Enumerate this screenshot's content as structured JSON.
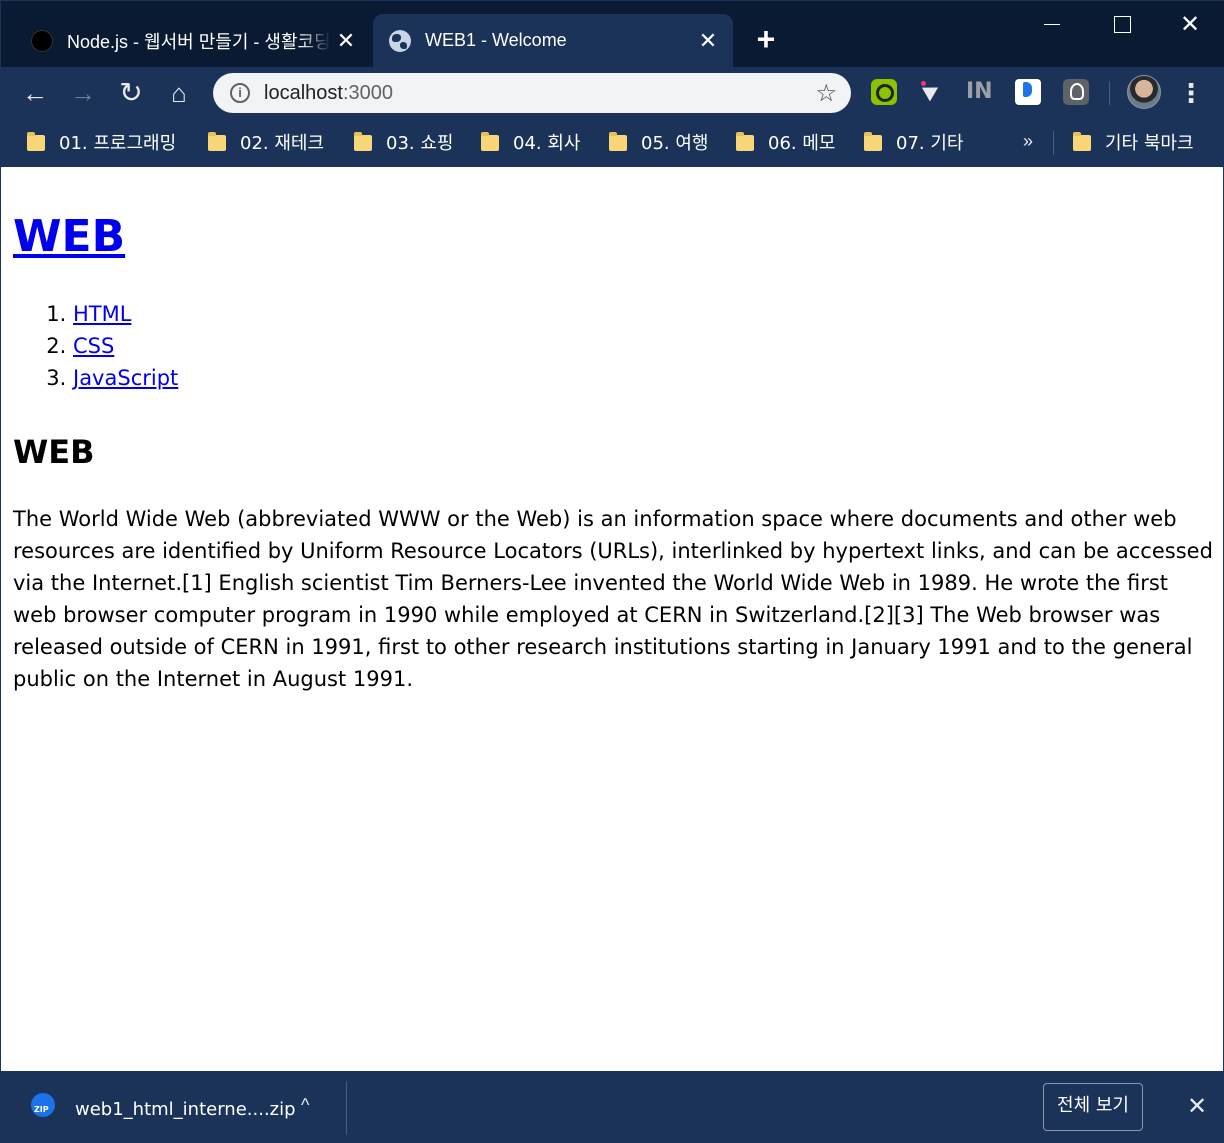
{
  "tabs": [
    {
      "title": "Node.js - 웹서버 만들기 - 생활코딩",
      "close": "✕"
    },
    {
      "title": "WEB1 - Welcome",
      "close": "✕"
    }
  ],
  "new_tab": "+",
  "window": {
    "close": "✕"
  },
  "nav": {
    "back": "←",
    "forward": "→",
    "reload": "↻",
    "home": "⌂"
  },
  "address": {
    "host": "localhost",
    "port": ":3000",
    "info": "i",
    "star": "☆"
  },
  "extensions": [
    "grammarly-icon",
    "cursor-icon",
    "nnn-icon",
    "papago-icon",
    "bulb-icon"
  ],
  "ext_text": {
    "nnn": "IN"
  },
  "menu": "⋮",
  "bookmarks": [
    "01. 프로그래밍",
    "02. 재테크",
    "03. 쇼핑",
    "04. 회사",
    "05. 여행",
    "06. 메모",
    "07. 기타"
  ],
  "bookmarks_more": "»",
  "other_bookmarks": "기타 북마크",
  "page": {
    "heading": "WEB",
    "links": [
      "HTML",
      "CSS",
      "JavaScript"
    ],
    "subheading": "WEB",
    "body": "The World Wide Web (abbreviated WWW or the Web) is an information space where documents and other web resources are identified by Uniform Resource Locators (URLs), interlinked by hypertext links, and can be accessed via the Internet.[1] English scientist Tim Berners-Lee invented the World Wide Web in 1989. He wrote the first web browser computer program in 1990 while employed at CERN in Switzerland.[2][3] The Web browser was released outside of CERN in 1991, first to other research institutions starting in January 1991 and to the general public on the Internet in August 1991."
  },
  "download": {
    "file": "web1_html_interne....zip",
    "icon_label": "ZIP",
    "caret": "^",
    "show_all": "전체 보기",
    "close": "✕"
  },
  "colors": {
    "frame": "#0b1a33",
    "toolbar": "#1b3358",
    "link": "#0000ee"
  }
}
